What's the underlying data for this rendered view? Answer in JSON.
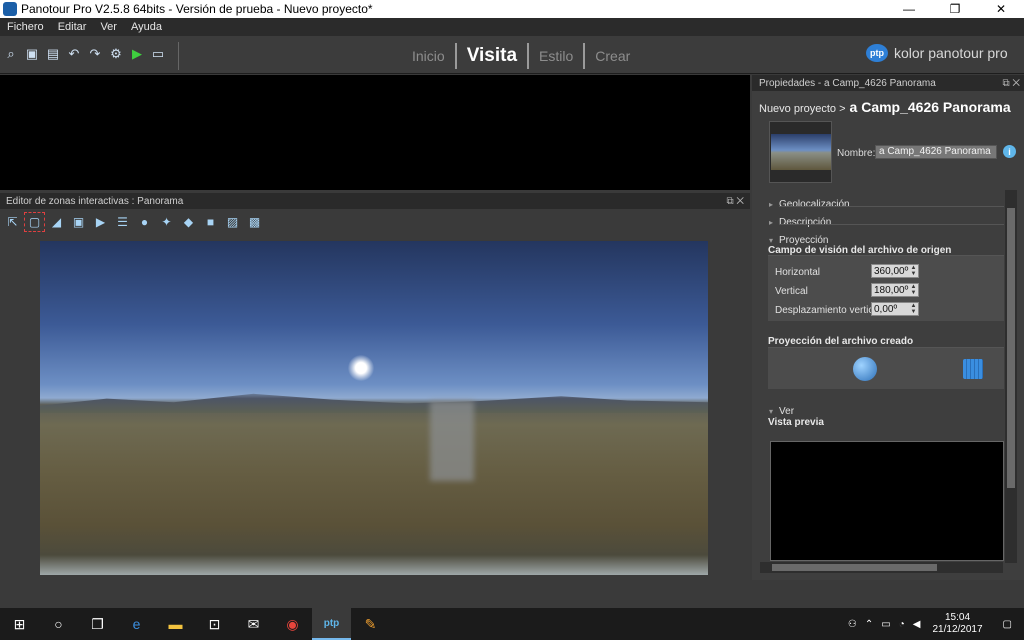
{
  "window": {
    "title": "Panotour Pro V2.5.8 64bits - Versión de prueba - Nuevo proyecto*",
    "minimize": "—",
    "maximize": "❐",
    "close": "✕"
  },
  "menu": [
    "Fichero",
    "Editar",
    "Ver",
    "Ayuda"
  ],
  "toolbar": {
    "icons": [
      "find-icon",
      "save-icon",
      "add-panorama-icon",
      "undo-icon",
      "redo-icon",
      "settings-icon",
      "play-icon",
      "publish-icon"
    ]
  },
  "tabs": [
    "Inicio",
    "Visita",
    "Estilo",
    "Crear"
  ],
  "active_tab": "Visita",
  "brand": {
    "logo": "ptp",
    "name": "kolor panotour pro"
  },
  "editor": {
    "title": "Editor de zonas interactivas : Panorama",
    "tools": [
      "select-icon",
      "rect-select-icon",
      "direction-spot-icon",
      "image-spot-icon",
      "video-spot-icon",
      "text-spot-icon",
      "sound-spot-icon",
      "light-spot-icon",
      "point-spot-icon",
      "polygon-spot-icon",
      "photo-spot-icon",
      "photo-add-icon"
    ]
  },
  "properties": {
    "header": "Propiedades - a Camp_4626 Panorama",
    "breadcrumb_parent": "Nuevo proyecto >",
    "breadcrumb_current": "a Camp_4626 Panorama",
    "name_label": "Nombre:",
    "name_value": "a Camp_4626 Panorama",
    "info": "i",
    "sections": {
      "geo": "Geolocalización",
      "desc": "Descripción",
      "proj": "Proyección",
      "ver": "Ver"
    },
    "source_fov_title": "Campo de visión del archivo de origen",
    "fields": {
      "horizontal_label": "Horizontal",
      "horizontal_value": "360,00º",
      "vertical_label": "Vertical",
      "vertical_value": "180,00º",
      "offset_label": "Desplazamiento vertical",
      "offset_value": "0,00º"
    },
    "output_projection_title": "Proyección del archivo creado",
    "preview_title": "Vista previa"
  },
  "taskbar": {
    "apps": [
      "windows-start-icon",
      "cortana-icon",
      "task-view-icon",
      "edge-icon",
      "file-explorer-icon",
      "store-icon",
      "mail-icon",
      "chrome-icon",
      "panotour-icon",
      "paint-icon"
    ],
    "time": "15:04",
    "date": "21/12/2017"
  }
}
